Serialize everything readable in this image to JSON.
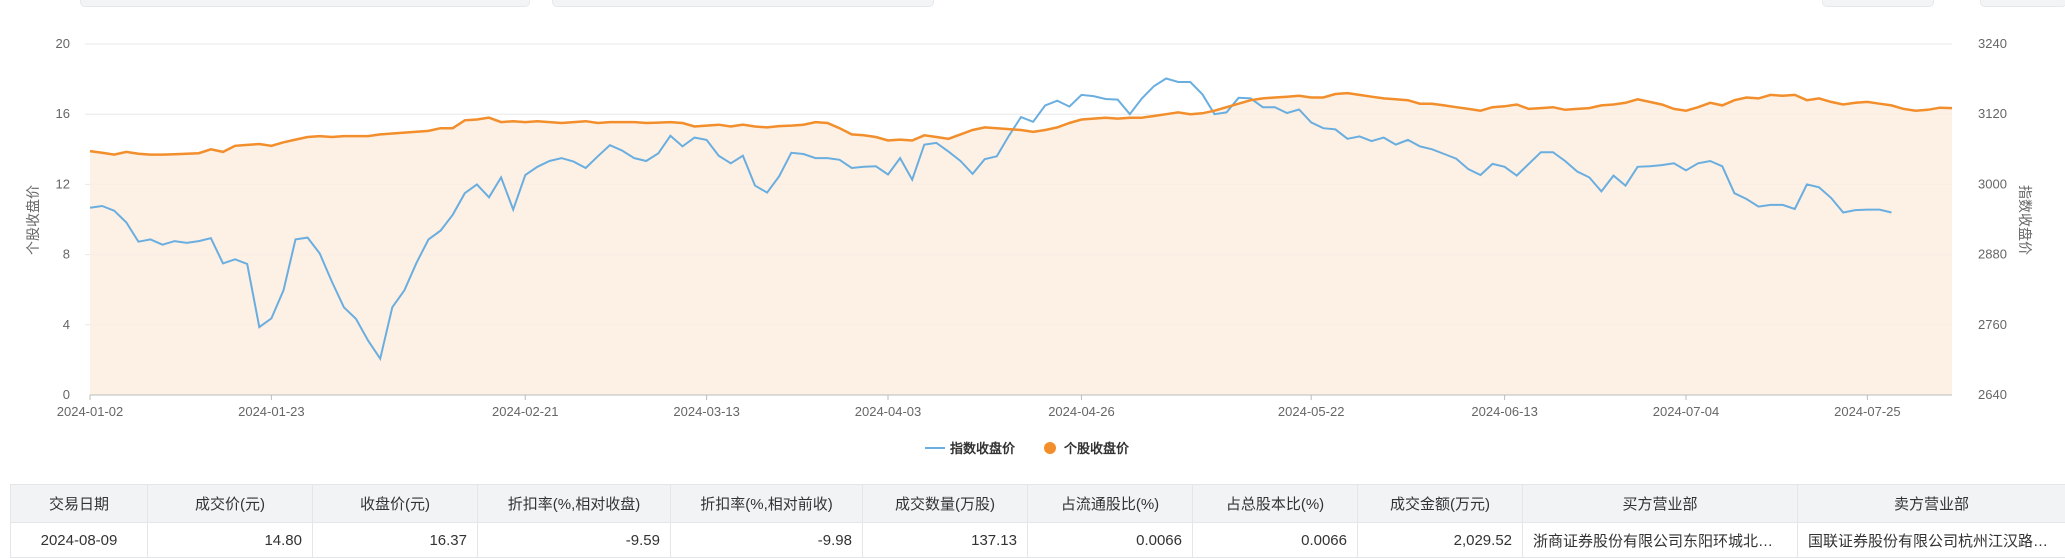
{
  "chart_data": {
    "type": "line",
    "x_axis_ticks": [
      "2024-01-02",
      "2024-01-23",
      "2024-02-21",
      "2024-03-13",
      "2024-04-03",
      "2024-04-26",
      "2024-05-22",
      "2024-06-13",
      "2024-07-04",
      "2024-07-25"
    ],
    "y_left": {
      "label": "个股收盘价",
      "ticks": [
        0,
        4,
        8,
        12,
        16,
        20
      ],
      "ylim": [
        0,
        20
      ]
    },
    "y_right": {
      "label": "指数收盘价",
      "ticks": [
        2640,
        2760,
        2880,
        3000,
        3120,
        3240
      ],
      "ylim": [
        2640,
        3240
      ]
    },
    "grid": true,
    "legend_position": "bottom",
    "series": [
      {
        "name": "指数收盘价",
        "axis": "right",
        "color": "#6aaee0",
        "values": [
          2960,
          2963,
          2955,
          2935,
          2902,
          2906,
          2897,
          2903,
          2900,
          2903,
          2908,
          2865,
          2872,
          2864,
          2756,
          2771,
          2819,
          2906,
          2909,
          2882,
          2834,
          2790,
          2770,
          2733,
          2702,
          2790,
          2819,
          2866,
          2906,
          2921,
          2948,
          2985,
          3000,
          2978,
          3012,
          2957,
          3016,
          3030,
          3040,
          3045,
          3039,
          3028,
          3048,
          3067,
          3058,
          3045,
          3040,
          3053,
          3083,
          3065,
          3080,
          3076,
          3049,
          3036,
          3049,
          2998,
          2986,
          3014,
          3054,
          3052,
          3045,
          3045,
          3042,
          3028,
          3030,
          3031,
          3017,
          3045,
          3008,
          3068,
          3071,
          3056,
          3040,
          3018,
          3043,
          3048,
          3083,
          3115,
          3107,
          3135,
          3143,
          3133,
          3153,
          3151,
          3146,
          3145,
          3120,
          3147,
          3168,
          3181,
          3175,
          3175,
          3154,
          3120,
          3123,
          3148,
          3147,
          3132,
          3132,
          3122,
          3128,
          3106,
          3096,
          3094,
          3078,
          3082,
          3074,
          3080,
          3068,
          3076,
          3065,
          3060,
          3052,
          3044,
          3026,
          3016,
          3035,
          3030,
          3015,
          3035,
          3055,
          3055,
          3040,
          3022,
          3012,
          2988,
          3015,
          2998,
          3030,
          3031,
          3033,
          3036,
          3024,
          3036,
          3040,
          3031,
          2985,
          2975,
          2962,
          2965,
          2965,
          2958,
          3000,
          2995,
          2977,
          2952,
          2956,
          2957,
          2957,
          2952
        ]
      },
      {
        "name": "个股收盘价",
        "axis": "left",
        "color": "#f28e2b",
        "values": [
          13.9,
          13.8,
          13.7,
          13.85,
          13.75,
          13.7,
          13.7,
          13.72,
          13.75,
          13.78,
          14.0,
          13.85,
          14.2,
          14.25,
          14.3,
          14.2,
          14.4,
          14.55,
          14.7,
          14.75,
          14.7,
          14.75,
          14.75,
          14.75,
          14.85,
          14.9,
          14.95,
          15.0,
          15.05,
          15.2,
          15.2,
          15.65,
          15.7,
          15.8,
          15.55,
          15.6,
          15.55,
          15.6,
          15.55,
          15.5,
          15.55,
          15.6,
          15.5,
          15.55,
          15.55,
          15.55,
          15.5,
          15.52,
          15.55,
          15.5,
          15.3,
          15.35,
          15.4,
          15.3,
          15.4,
          15.3,
          15.25,
          15.32,
          15.35,
          15.4,
          15.55,
          15.5,
          15.2,
          14.85,
          14.8,
          14.7,
          14.5,
          14.55,
          14.5,
          14.8,
          14.7,
          14.6,
          14.85,
          15.1,
          15.25,
          15.2,
          15.15,
          15.1,
          15.0,
          15.1,
          15.25,
          15.5,
          15.7,
          15.75,
          15.8,
          15.75,
          15.8,
          15.8,
          15.9,
          16.0,
          16.1,
          16.0,
          16.05,
          16.2,
          16.4,
          16.6,
          16.8,
          16.9,
          16.95,
          17.0,
          17.05,
          16.95,
          16.95,
          17.15,
          17.2,
          17.1,
          17.0,
          16.9,
          16.85,
          16.8,
          16.6,
          16.6,
          16.5,
          16.4,
          16.3,
          16.2,
          16.4,
          16.45,
          16.55,
          16.3,
          16.35,
          16.4,
          16.25,
          16.3,
          16.35,
          16.5,
          16.55,
          16.65,
          16.85,
          16.7,
          16.55,
          16.3,
          16.2,
          16.4,
          16.65,
          16.5,
          16.8,
          16.95,
          16.9,
          17.1,
          17.05,
          17.1,
          16.8,
          16.9,
          16.7,
          16.55,
          16.65,
          16.7,
          16.6,
          16.5,
          16.3,
          16.2,
          16.25,
          16.37,
          16.35
        ]
      }
    ]
  },
  "table": {
    "headers": [
      "交易日期",
      "成交价(元)",
      "收盘价(元)",
      "折扣率(%,相对收盘)",
      "折扣率(%,相对前收)",
      "成交数量(万股)",
      "占流通股比(%)",
      "占总股本比(%)",
      "成交金额(万元)",
      "买方营业部",
      "卖方营业部"
    ],
    "rows": [
      [
        "2024-08-09",
        "14.80",
        "16.37",
        "-9.59",
        "-9.98",
        "137.13",
        "0.0066",
        "0.0066",
        "2,029.52",
        "浙商证券股份有限公司东阳环城北路证券营业部",
        "国联证券股份有限公司杭州江汉路证券营业部"
      ]
    ]
  }
}
